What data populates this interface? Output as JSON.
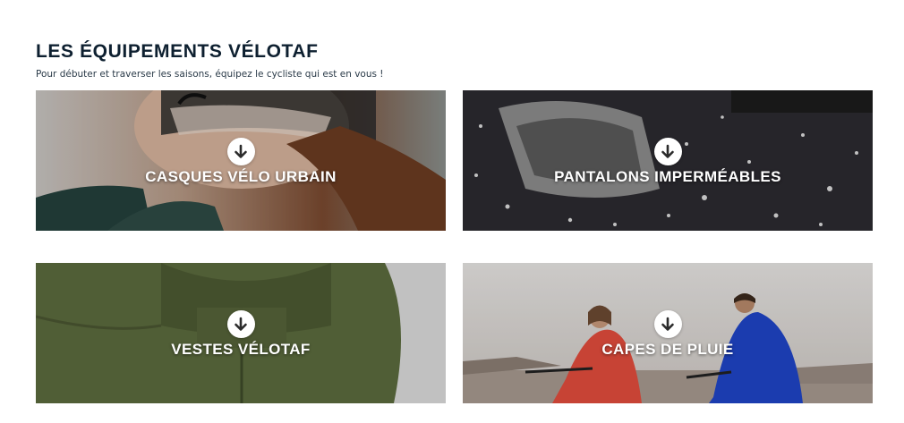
{
  "section": {
    "title": "LES ÉQUIPEMENTS VÉLOTAF",
    "subtitle": "Pour débuter et traverser les saisons, équipez le cycliste qui est en vous !"
  },
  "cards": [
    {
      "label": "CASQUES VÉLO URBAIN",
      "icon": "arrow-down-icon"
    },
    {
      "label": "PANTALONS IMPERMÉABLES",
      "icon": "arrow-down-icon"
    },
    {
      "label": "VESTES VÉLOTAF",
      "icon": "arrow-down-icon"
    },
    {
      "label": "CAPES DE PLUIE",
      "icon": "arrow-down-icon"
    }
  ],
  "colors": {
    "title": "#0e2030",
    "label": "#ffffff",
    "icon_bg": "#ffffff",
    "icon_fg": "#2b2b2b"
  }
}
